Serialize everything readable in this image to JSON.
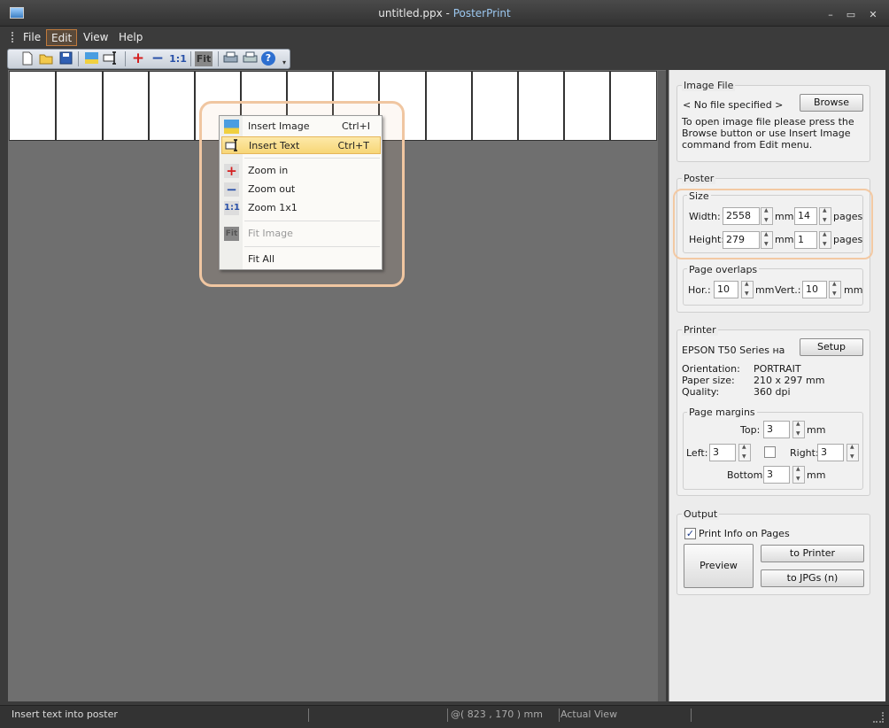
{
  "window": {
    "filename": "untitled.ppx - ",
    "app": "PosterPrint",
    "min": "–",
    "max": "▭",
    "close": "✕"
  },
  "menubar": [
    "File",
    "Edit",
    "View",
    "Help"
  ],
  "toolbar": {
    "zoom1x1": "1:1",
    "fit": "Fit",
    "help": "?"
  },
  "popup": {
    "items": [
      {
        "label": "Insert Image",
        "shortcut": "Ctrl+I"
      },
      {
        "label": "Insert Text",
        "shortcut": "Ctrl+T"
      },
      {
        "label": "Zoom in",
        "shortcut": ""
      },
      {
        "label": "Zoom out",
        "shortcut": ""
      },
      {
        "label": "Zoom 1x1",
        "shortcut": ""
      },
      {
        "label": "Fit Image",
        "shortcut": ""
      },
      {
        "label": "Fit All",
        "shortcut": ""
      }
    ],
    "icons": {
      "zoomin": "+",
      "zoomout": "−",
      "zoom1x1": "1:1",
      "fit": "Fit"
    }
  },
  "image_file": {
    "title": "Image File",
    "value": "< No file specified >",
    "browse": "Browse",
    "hint": "To open image file please press the Browse button or use Insert Image command from Edit menu."
  },
  "poster": {
    "title": "Poster",
    "size": {
      "title": "Size",
      "width_label": "Width:",
      "width": "2558",
      "width_pages": "14",
      "height_label": "Height:",
      "height": "279",
      "height_pages": "1",
      "mm": "mm",
      "pages": "pages"
    },
    "overlaps": {
      "title": "Page overlaps",
      "hor_label": "Hor.:",
      "hor": "10",
      "vert_label": "Vert.:",
      "vert": "10",
      "mm": "mm"
    }
  },
  "printer": {
    "title": "Printer",
    "setup": "Setup",
    "name": "EPSON T50 Series на",
    "orientation_label": "Orientation:",
    "orientation": "PORTRAIT",
    "paper_label": "Paper size:",
    "paper": "210 x 297 mm",
    "quality_label": "Quality:",
    "quality": "360 dpi",
    "margins": {
      "title": "Page margins",
      "top_label": "Top:",
      "top": "3",
      "left_label": "Left:",
      "left": "3",
      "right_label": "Right:",
      "right": "3",
      "bottom_label": "Bottom:",
      "bottom": "3",
      "mm": "mm"
    }
  },
  "output": {
    "title": "Output",
    "print_info": "Print Info on Pages",
    "preview": "Preview",
    "to_printer": "to Printer",
    "to_jpgs": "to JPGs (n)"
  },
  "status": {
    "message": "Insert text into poster",
    "coords": "@( 823 , 170 ) mm",
    "view": "Actual View"
  }
}
